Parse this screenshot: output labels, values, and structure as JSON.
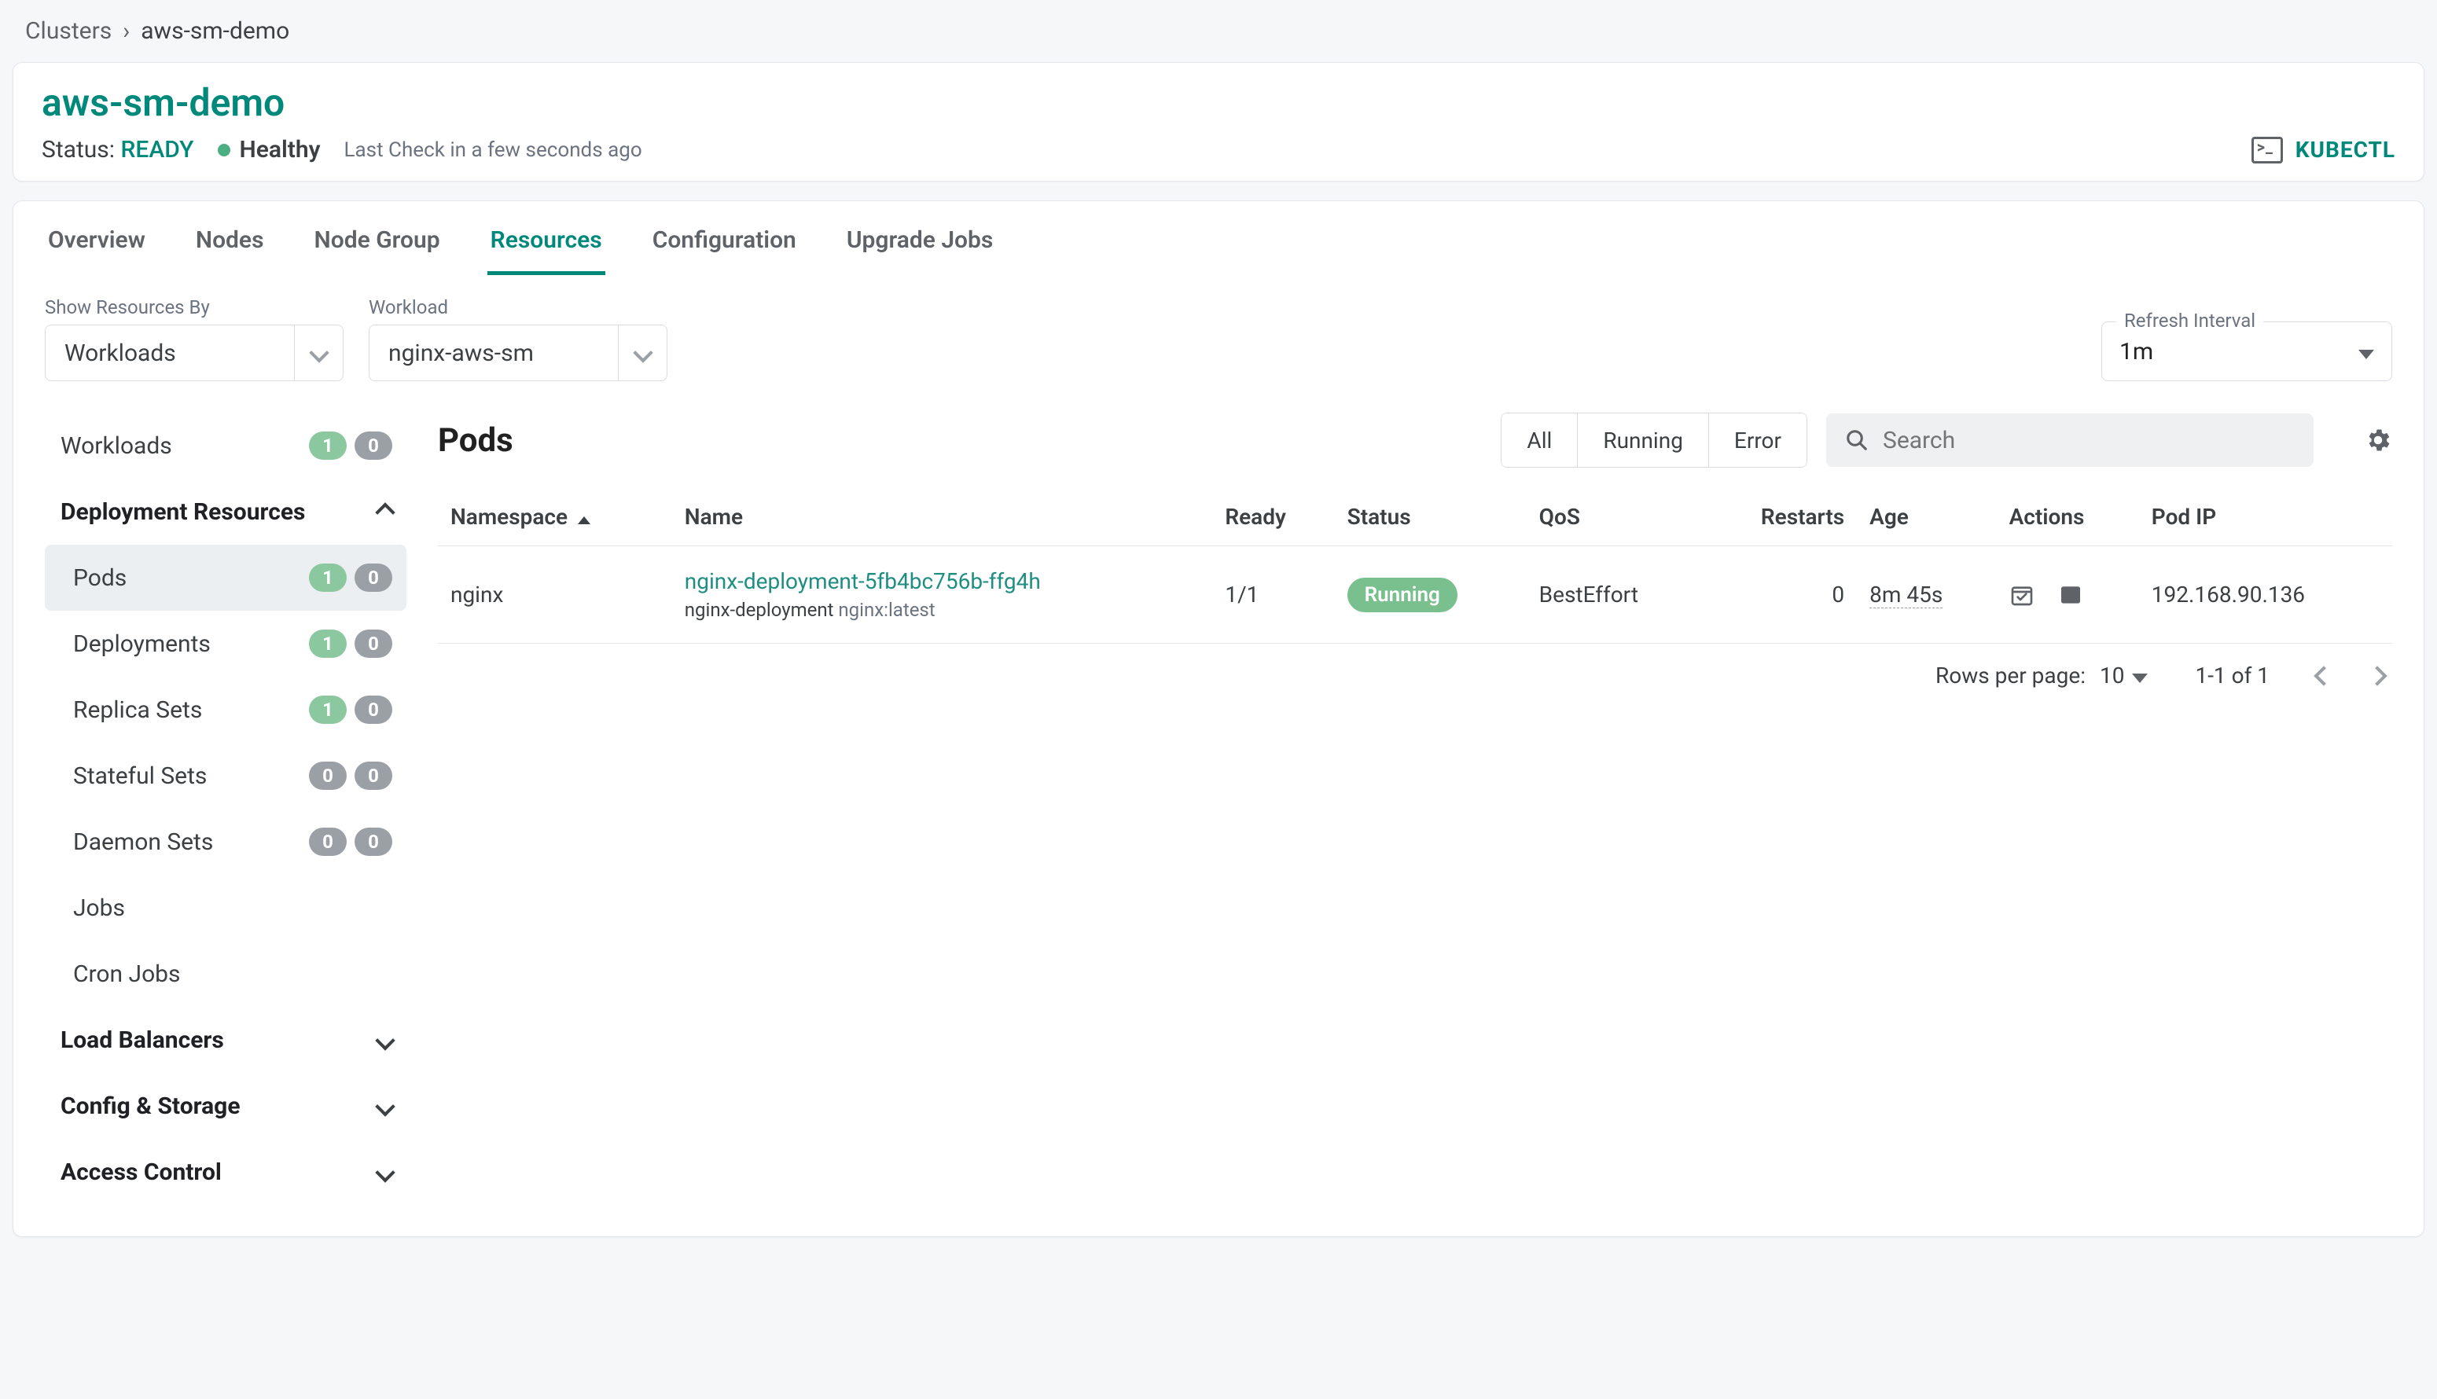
{
  "breadcrumb": {
    "root": "Clusters",
    "sep": "›",
    "current": "aws-sm-demo"
  },
  "header": {
    "title": "aws-sm-demo",
    "status_label": "Status:",
    "status_value": "READY",
    "health": "Healthy",
    "last_check": "Last Check in a few seconds ago",
    "kubectl": "KUBECTL"
  },
  "tabs": [
    "Overview",
    "Nodes",
    "Node Group",
    "Resources",
    "Configuration",
    "Upgrade Jobs"
  ],
  "active_tab": "Resources",
  "filters": {
    "show_by_label": "Show Resources By",
    "show_by_value": "Workloads",
    "workload_label": "Workload",
    "workload_value": "nginx-aws-sm",
    "refresh_label": "Refresh Interval",
    "refresh_value": "1m"
  },
  "sidebar": {
    "top": {
      "label": "Workloads",
      "green": "1",
      "grey": "0"
    },
    "section_deploy": "Deployment Resources",
    "items": [
      {
        "label": "Pods",
        "green": "1",
        "grey": "0",
        "active": true
      },
      {
        "label": "Deployments",
        "green": "1",
        "grey": "0"
      },
      {
        "label": "Replica Sets",
        "green": "1",
        "grey": "0"
      },
      {
        "label": "Stateful Sets",
        "green": "0",
        "grey": "0",
        "green_is_grey": true
      },
      {
        "label": "Daemon Sets",
        "green": "0",
        "grey": "0",
        "green_is_grey": true
      },
      {
        "label": "Jobs"
      },
      {
        "label": "Cron Jobs"
      }
    ],
    "groups": [
      "Load Balancers",
      "Config & Storage",
      "Access Control"
    ]
  },
  "content": {
    "title": "Pods",
    "seg": [
      "All",
      "Running",
      "Error"
    ],
    "search_placeholder": "Search",
    "columns": [
      "Namespace",
      "Name",
      "Ready",
      "Status",
      "QoS",
      "Restarts",
      "Age",
      "Actions",
      "Pod IP"
    ],
    "sort_col": "Namespace",
    "rows": [
      {
        "namespace": "nginx",
        "name": "nginx-deployment-5fb4bc756b-ffg4h",
        "sub_dep": "nginx-deployment",
        "sub_img": "nginx:latest",
        "ready": "1/1",
        "status": "Running",
        "qos": "BestEffort",
        "restarts": "0",
        "age": "8m 45s",
        "pod_ip": "192.168.90.136"
      }
    ],
    "pagination": {
      "rpp_label": "Rows per page:",
      "rpp_value": "10",
      "range": "1-1 of 1"
    }
  }
}
